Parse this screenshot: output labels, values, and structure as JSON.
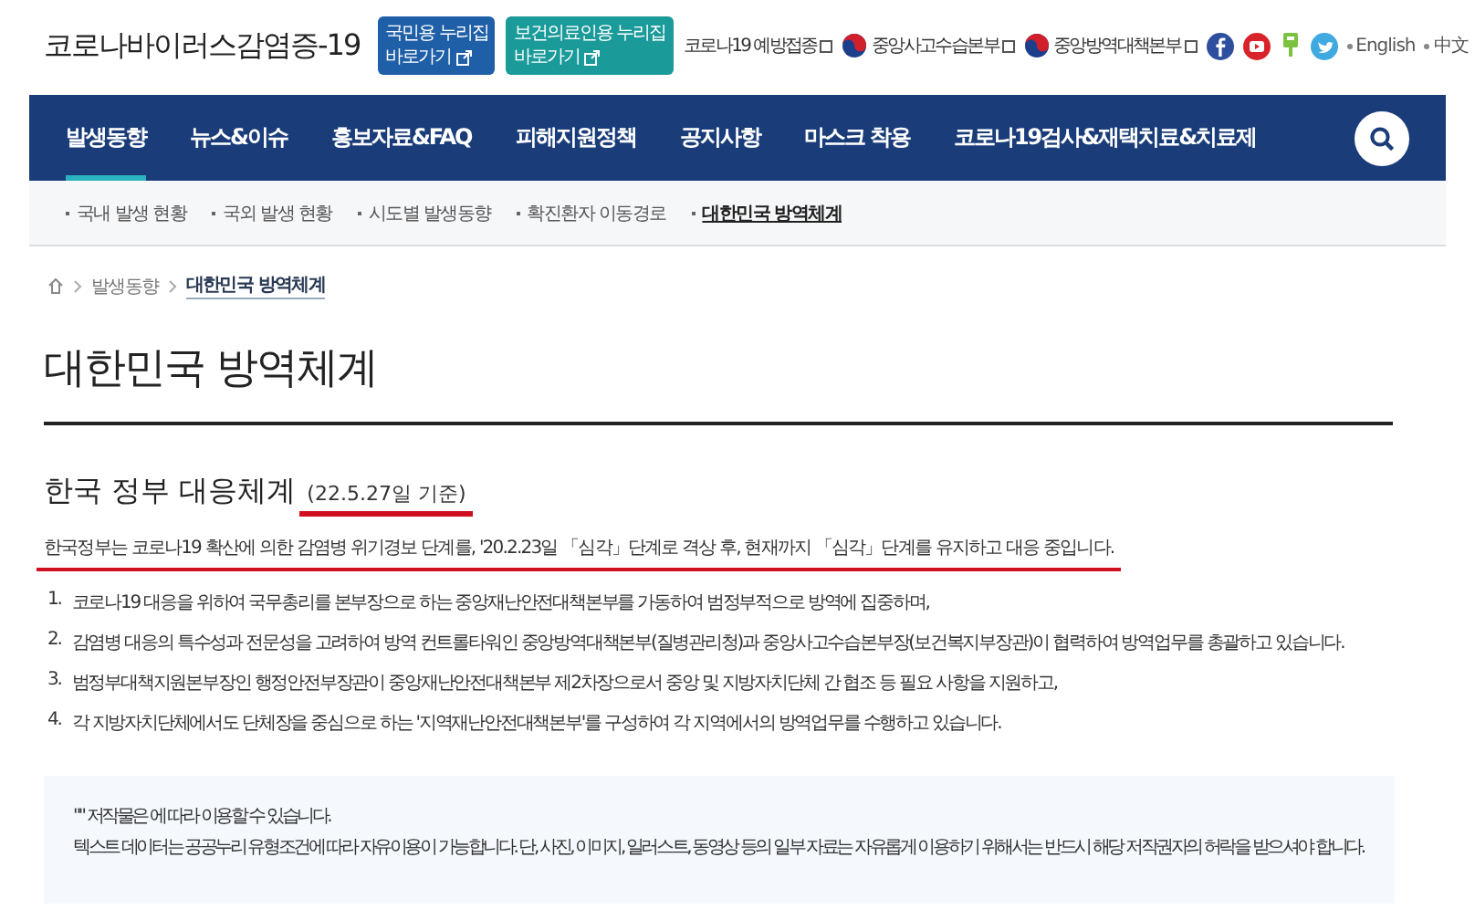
{
  "header": {
    "logo": "코로나바이러스감염증-19",
    "portal_buttons": [
      {
        "line1": "국민용 누리집",
        "line2": "바로가기",
        "color": "#1f5fa8"
      },
      {
        "line1": "보건의료인용 누리집",
        "line2": "바로가기",
        "color": "#1b9a9a"
      }
    ],
    "links": [
      {
        "label": "코로나19 예방접종",
        "emblem": false
      },
      {
        "label": "중앙사고수습본부",
        "emblem": true
      },
      {
        "label": "중앙방역대책본부",
        "emblem": true
      }
    ],
    "languages": [
      "English",
      "中文"
    ]
  },
  "nav": {
    "tabs": [
      {
        "label": "발생동향",
        "selected": true
      },
      {
        "label": "뉴스&이슈",
        "selected": false
      },
      {
        "label": "홍보자료&FAQ",
        "selected": false
      },
      {
        "label": "피해지원정책",
        "selected": false
      },
      {
        "label": "공지사항",
        "selected": false
      },
      {
        "label": "마스크 착용",
        "selected": false
      },
      {
        "label": "코로나19검사&재택치료&치료제",
        "selected": false
      }
    ]
  },
  "subnav": [
    {
      "label": "국내 발생 현황",
      "selected": false
    },
    {
      "label": "국외 발생 현황",
      "selected": false
    },
    {
      "label": "시도별 발생동향",
      "selected": false
    },
    {
      "label": "확진환자 이동경로",
      "selected": false
    },
    {
      "label": "대한민국 방역체계",
      "selected": true
    }
  ],
  "breadcrumb": [
    "발생동향",
    "대한민국 방역체계"
  ],
  "title": "대한민국 방역체계",
  "section": {
    "heading": "한국 정부 대응체계",
    "date": "(22.5.27일 기준)",
    "intro": "한국정부는 코로나19 확산에 의한 감염병 위기경보 단계를, '20.2.23일 「심각」단계로 격상 후, 현재까지 「심각」단계를 유지하고 대응 중입니다.",
    "items": [
      {
        "number": "1.",
        "text": "코로나19 대응을 위하여 국무총리를 본부장으로 하는 중앙재난안전대책본부를 가동하여 범정부적으로 방역에 집중하며,"
      },
      {
        "number": "2.",
        "text": "감염병 대응의 특수성과 전문성을 고려하여 방역 컨트롤타워인 중앙방역대책본부(질병관리청)과 중앙사고수습본부장(보건복지부장관)이 협력하여 방역업무를 총괄하고 있습니다."
      },
      {
        "number": "3.",
        "text": "범정부대책지원본부장인 행정안전부장관이 중앙재난안전대책본부 제2차장으로서 중앙 및 지방자치단체 간 협조 등 필요 사항을 지원하고,"
      },
      {
        "number": "4.",
        "text": "각 지방자치단체에서도 단체장을 중심으로 하는 '지역재난안전대책본부'를 구성하여 각 지역에서의 방역업무를 수행하고 있습니다."
      }
    ]
  },
  "copyright": {
    "line1": "\"\" 저작물은 에 따라 이용할 수 있습니다.",
    "line2": "텍스트 데이터는 공공누리 유형조건에 따라 자유이용이 가능합니다. 단, 사진, 이미지, 일러스트, 동영상 등의 일부 자료는 자유롭게 이용하기 위해서는 반드시 해당 저작권자의 허락을 받으셔야 합니다."
  }
}
